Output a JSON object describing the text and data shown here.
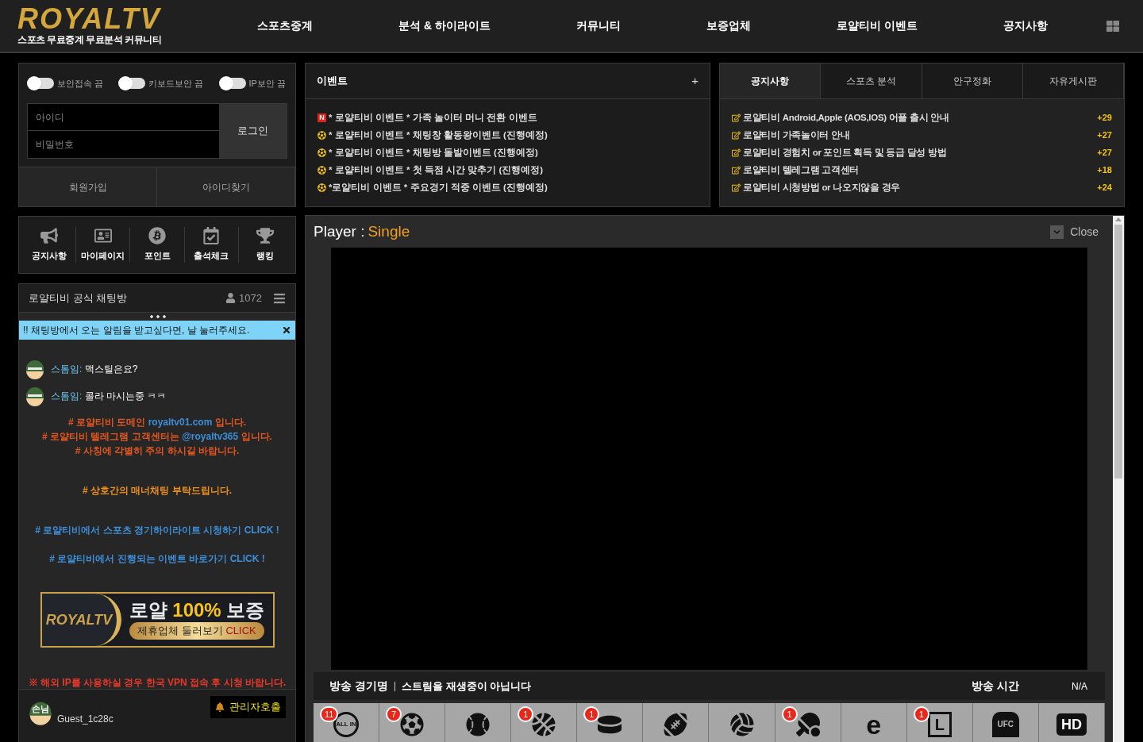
{
  "logo": {
    "wordmark": "ROYALTV",
    "tagline": "스포츠 무료중계 무료분석 커뮤니티"
  },
  "nav": [
    {
      "label": "스포츠중계"
    },
    {
      "label": "분석 & 하이라이트"
    },
    {
      "label": "커뮤니티"
    },
    {
      "label": "보증업체"
    },
    {
      "label": "로얄티비 이벤트"
    },
    {
      "label": "공지사항"
    }
  ],
  "security_toggles": [
    {
      "label": "보안접속 끔",
      "on": false
    },
    {
      "label": "키보드보안 끔",
      "on": false
    },
    {
      "label": "IP보안 끔",
      "on": false
    }
  ],
  "login": {
    "id_placeholder": "아이디",
    "password_placeholder": "비밀번호",
    "login_button": "로그인",
    "links": [
      "회원가입",
      "아이디찾기"
    ]
  },
  "events": {
    "title": "이벤트",
    "more": "+",
    "items": [
      {
        "kind": "new",
        "badge": "N",
        "text": "* 로얄티비 이벤트 * 가족 놀이터 머니 전환 이벤트"
      },
      {
        "kind": "ball",
        "text": "* 로얄티비 이벤트 * 채팅창 활동왕이벤트 (진행예정)"
      },
      {
        "kind": "ball",
        "text": "* 로얄티비 이벤트 * 채팅방 돌발이벤트 (진행예정)"
      },
      {
        "kind": "ball",
        "text": "* 로얄티비 이벤트 * 첫 득점 시간 맞추기 (진행예정)"
      },
      {
        "kind": "ball",
        "text": "*로얄티비 이벤트 * 주요경기 적중 이벤트 (진행예정)"
      }
    ]
  },
  "board": {
    "tabs": [
      {
        "label": "공지사항",
        "selected": true
      },
      {
        "label": "스포츠 분석",
        "selected": false
      },
      {
        "label": "안구정화",
        "selected": false
      },
      {
        "label": "자유게시판",
        "selected": false
      }
    ],
    "posts": [
      {
        "title": "로얄티비 Android,Apple (AOS,IOS) 어플 출시 안내",
        "count": "+29"
      },
      {
        "title": "로얄티비 가족놀이터 안내",
        "count": "+27"
      },
      {
        "title": "로얄티비 경험치 or 포인트 획득 및 등급 달성 방법",
        "count": "+27"
      },
      {
        "title": "로얄티비 텔레그램 고객센터",
        "count": "+18"
      },
      {
        "title": "로얄티비 시청방법 or 나오지않을 경우",
        "count": "+24"
      }
    ]
  },
  "quick_menu": [
    {
      "kind": "megaphone",
      "label": "공지사항"
    },
    {
      "kind": "profile",
      "label": "마이페이지"
    },
    {
      "kind": "bitcoin",
      "label": "포인트"
    },
    {
      "kind": "calendar",
      "label": "출석체크"
    },
    {
      "kind": "trophy",
      "label": "랭킹"
    }
  ],
  "chat": {
    "title": "로얄티비 공식 채팅방",
    "users": "1072",
    "notify_bar": "!! 채팅방에서 오는 알림을 받고싶다면, 날 눌러주세요.",
    "messages": [
      {
        "kind": "user",
        "name": "스톰임:",
        "text": "맥스틸은요?"
      },
      {
        "kind": "user",
        "name": "스톰임:",
        "text": "콜라 마시는중 ㅋㅋ"
      },
      {
        "kind": "notice",
        "color": "#e2561f",
        "before": "# 로얄티비 도메인 ",
        "link": "royaltv01.com",
        "after": " 입니다."
      },
      {
        "kind": "notice",
        "color": "#e2561f",
        "before": "# 로얄티비 텔레그램 고객센터는 ",
        "link": "@royaltv365",
        "after": " 입니다."
      },
      {
        "kind": "notice",
        "color": "#e2561f",
        "before": "# 사칭에 각별히 주의 하시길 바랍니다."
      },
      {
        "kind": "notice",
        "color": "#f0901c",
        "before": "# 상호간의 매너채팅 부탁드립니다."
      },
      {
        "kind": "notice",
        "color": "#3d8fd9",
        "before": "# 로얄티비에서 스포츠 경기하이라이트 시청하기 CLICK !"
      },
      {
        "kind": "notice",
        "color": "#3d8fd9",
        "before": "# 로얄티비에서 진행되는 이벤트 바로가기 CLICK !"
      },
      {
        "kind": "banner",
        "logo": "ROYALTV",
        "headline_left": "로얄",
        "headline_mid": "100%",
        "headline_right": "보증",
        "pill": "제휴업체 둘러보기",
        "pill_cta": "CLICK"
      },
      {
        "kind": "notice",
        "color": "#e8382a",
        "before": "※ 해외 IP를 사용하실 경우 한국 VPN 접속 후 시청 바랍니다."
      }
    ],
    "guest": {
      "badge": "손님",
      "name": "Guest_1c28c"
    },
    "call_button": "관리자호출"
  },
  "player": {
    "label": "Player :",
    "mode": "Single",
    "close": "Close",
    "info": {
      "name_label": "방송 경기명",
      "name_value": "스트림을 재생중이 아닙니다",
      "time_label": "방송 시간",
      "time_value": "N/A"
    }
  },
  "sports": [
    {
      "kind": "allin",
      "mark": "ALL IN",
      "badge": "11"
    },
    {
      "kind": "soccer",
      "badge": "7"
    },
    {
      "kind": "baseball"
    },
    {
      "kind": "basketball",
      "badge": "1"
    },
    {
      "kind": "hockey",
      "badge": "1"
    },
    {
      "kind": "football"
    },
    {
      "kind": "volleyball"
    },
    {
      "kind": "tennis",
      "badge": "1"
    },
    {
      "kind": "esports",
      "mark": "e"
    },
    {
      "kind": "lol",
      "mark": "L",
      "badge": "1"
    },
    {
      "kind": "ufc",
      "mark": "UFC"
    },
    {
      "kind": "hd",
      "mark": "HD"
    }
  ]
}
